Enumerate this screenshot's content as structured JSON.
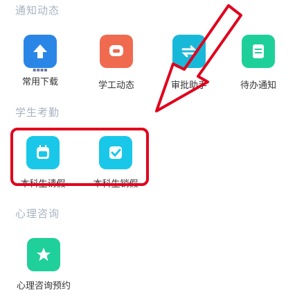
{
  "sections": {
    "notify": {
      "title": "通知动态",
      "items": [
        {
          "label": "常用下载",
          "icon": "download-icon",
          "color": "#2a86e6",
          "sub": "▪▪▪▪"
        },
        {
          "label": "学工动态",
          "icon": "chat-bubble-icon",
          "color": "#f06a4f"
        },
        {
          "label": "审批助手",
          "icon": "approval-icon",
          "color": "#18b8d8"
        },
        {
          "label": "待办通知",
          "icon": "document-icon",
          "color": "#1fcf9a"
        }
      ]
    },
    "attendance": {
      "title": "学生考勤",
      "items": [
        {
          "label": "本科生请假",
          "icon": "calendar-icon",
          "color": "#19c8e8"
        },
        {
          "label": "本科生销假",
          "icon": "check-shield-icon",
          "color": "#19c8e8"
        }
      ]
    },
    "counseling": {
      "title": "心理咨询",
      "items": [
        {
          "label": "心理咨询预约",
          "icon": "star-icon",
          "color": "#1fd09a"
        }
      ]
    }
  },
  "annotation": {
    "highlight_color": "#e1001c",
    "arrow_color": "#e1001c"
  }
}
